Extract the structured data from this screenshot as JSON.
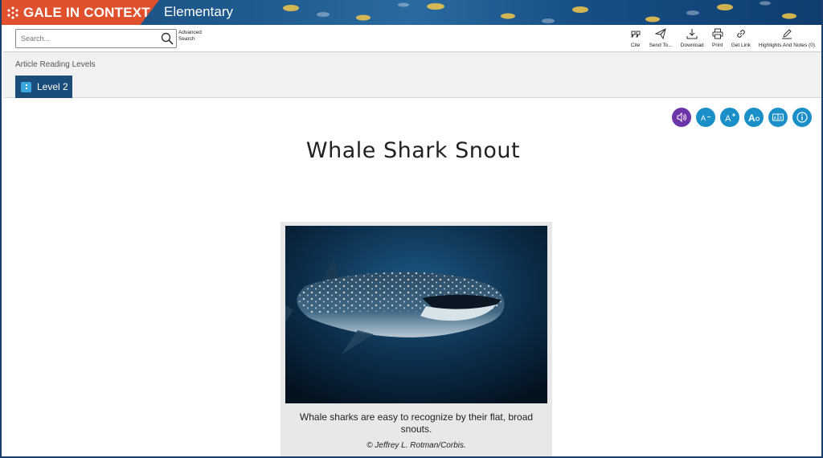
{
  "banner": {
    "brand": "GALE IN CONTEXT",
    "product": "Elementary",
    "brand_color": "#e0502d"
  },
  "toolbar": {
    "search_placeholder": "Search...",
    "advanced_search_line1": "Advanced",
    "advanced_search_line2": "Search",
    "tools": [
      {
        "label": "Cite",
        "icon": "quote-icon"
      },
      {
        "label": "Send To...",
        "icon": "send-icon"
      },
      {
        "label": "Download",
        "icon": "download-icon"
      },
      {
        "label": "Print",
        "icon": "print-icon"
      },
      {
        "label": "Get Link",
        "icon": "link-icon"
      },
      {
        "label": "Highlights And Notes (0)",
        "icon": "pencil-icon"
      }
    ]
  },
  "reading_levels": {
    "title": "Article Reading Levels",
    "active_tab": "Level 2"
  },
  "accessibility_tools": [
    {
      "icon": "speaker-icon",
      "color": "#6b35a8",
      "glyph": ""
    },
    {
      "icon": "decrease-font-icon",
      "color": "#1a8fc8",
      "glyph": "A-"
    },
    {
      "icon": "increase-font-icon",
      "color": "#1a8fc8",
      "glyph": "A+"
    },
    {
      "icon": "font-settings-icon",
      "color": "#1a8fc8",
      "glyph": "A"
    },
    {
      "icon": "translate-icon",
      "color": "#1a8fc8",
      "glyph": "A|B"
    },
    {
      "icon": "info-icon",
      "color": "#1a8fc8",
      "glyph": "i"
    }
  ],
  "article": {
    "title": "Whale Shark Snout",
    "image_caption": "Whale sharks are easy to recognize by their flat, broad snouts.",
    "image_credit": "© Jeffrey L. Rotman/Corbis."
  }
}
